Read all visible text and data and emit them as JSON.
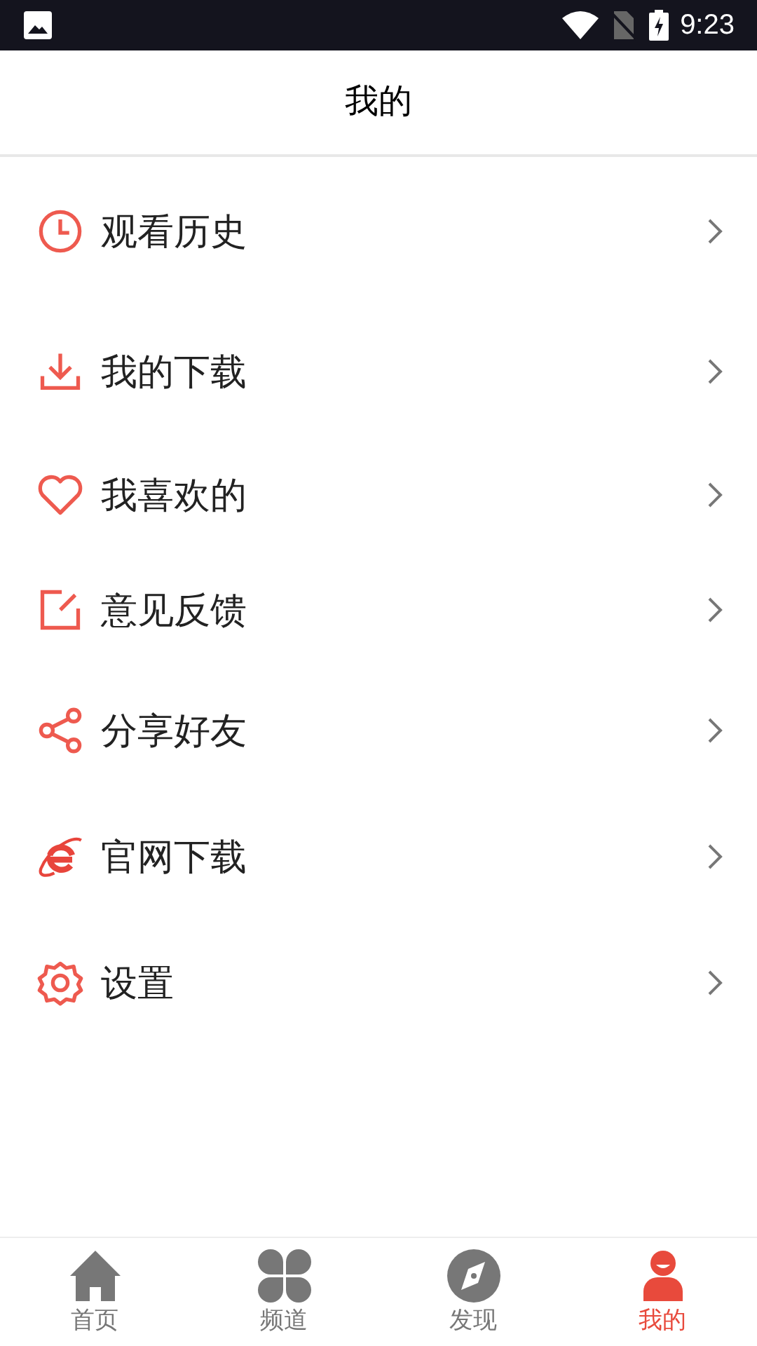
{
  "status_bar": {
    "time": "9:23"
  },
  "header": {
    "title": "我的"
  },
  "menu": [
    {
      "kind": "history",
      "label": "观看历史"
    },
    {
      "kind": "download",
      "label": "我的下载"
    },
    {
      "kind": "favorite",
      "label": "我喜欢的"
    },
    {
      "kind": "feedback",
      "label": "意见反馈"
    },
    {
      "kind": "share",
      "label": "分享好友"
    },
    {
      "kind": "website",
      "label": "官网下载"
    },
    {
      "kind": "settings",
      "label": "设置"
    }
  ],
  "tabs": [
    {
      "kind": "home",
      "label": "首页",
      "selected": false
    },
    {
      "kind": "channels",
      "label": "频道",
      "selected": false
    },
    {
      "kind": "discover",
      "label": "发现",
      "selected": false
    },
    {
      "kind": "me",
      "label": "我的",
      "selected": true
    }
  ]
}
